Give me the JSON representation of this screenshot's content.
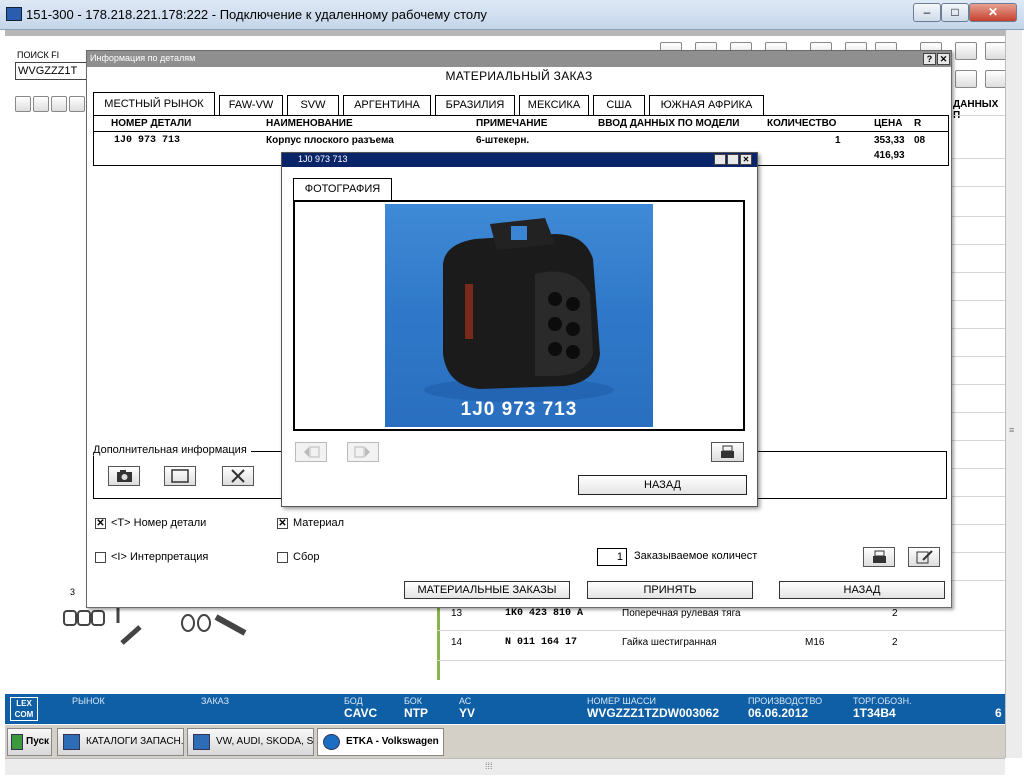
{
  "window": {
    "title": "151-300 - 178.218.221.178:222 - Подключение к удаленному рабочему столу",
    "minimize": "–",
    "maximize": "□",
    "close": "✕"
  },
  "bg": {
    "search_label": "ПОИСК FI",
    "search_value": "WVGZZZ1T",
    "right_header_fragment": "ДАННЫХ П",
    "rows": [
      {
        "pos": "13",
        "code": "1K0 423 810 A",
        "name": "Поперечная рулевая тяга",
        "spec": "",
        "qty": "2"
      },
      {
        "pos": "14",
        "code": "N   011 164 17",
        "name": "Гайка шестигранная",
        "spec": "M16",
        "qty": "2"
      }
    ],
    "callout": "3"
  },
  "status": {
    "logo": "LEX\nCOM",
    "market_label": "РЫНОК",
    "order_label": "ЗАКАЗ",
    "bod_label": "БОД",
    "bod_value": "CAVC",
    "bok_label": "БОК",
    "bok_value": "NTP",
    "ac_label": "АС",
    "ac_value": "YV",
    "chassis_label": "НОМЕР ШАССИ",
    "chassis_value": "WVGZZZ1TZDW003062",
    "prod_label": "ПРОИЗВОДСТВО",
    "prod_value": "06.06.2012",
    "trade_label": "ТОРГ.ОБОЗН.",
    "trade_value": "1T34B4",
    "edge_value": "6"
  },
  "taskbar": {
    "start": "Пуск",
    "items": [
      "КАТАЛОГИ ЗАПАСН...",
      "VW, AUDI, SKODA, S...",
      "ETKA - Volkswagen"
    ]
  },
  "dialog": {
    "title": "Информация по деталям",
    "help": "?",
    "close": "✕",
    "heading": "МАТЕРИАЛЬНЫЙ ЗАКАЗ",
    "tabs": [
      "МЕСТНЫЙ РЫНОК",
      "FAW-VW",
      "SVW",
      "АРГЕНТИНА",
      "БРАЗИЛИЯ",
      "МЕКСИКА",
      "США",
      "ЮЖНАЯ АФРИКА"
    ],
    "columns": {
      "part": "НОМЕР ДЕТАЛИ",
      "name": "НАИМЕНОВАНИЕ",
      "note": "ПРИМЕЧАНИЕ",
      "model": "ВВОД ДАННЫХ ПО МОДЕЛИ",
      "qty": "КОЛИЧЕСТВО",
      "price": "ЦЕНА",
      "r": "R"
    },
    "row": {
      "part": "1J0 973 713",
      "name": "Корпус плоского разъема",
      "note": "6-штекерн.",
      "qty": "1",
      "price": "353,33",
      "price2": "416,93",
      "r": "08"
    },
    "additional_info": "Дополнительная информация",
    "chk_part_label": "<T> Номер детали",
    "chk_material_label": "Материал",
    "chk_interp_label": "<I> Интерпретация",
    "chk_assembly_label": "Сбор",
    "order_qty_value": "1",
    "order_qty_label": "Заказываемое количест",
    "btn_orders": "МАТЕРИАЛЬНЫЕ ЗАКАЗЫ",
    "btn_accept": "ПРИНЯТЬ",
    "btn_back": "НАЗАД"
  },
  "popup": {
    "title": "1J0 973 713",
    "tab": "ФОТОГРАФИЯ",
    "photo_caption": "1J0 973 713",
    "back": "НАЗАД"
  }
}
